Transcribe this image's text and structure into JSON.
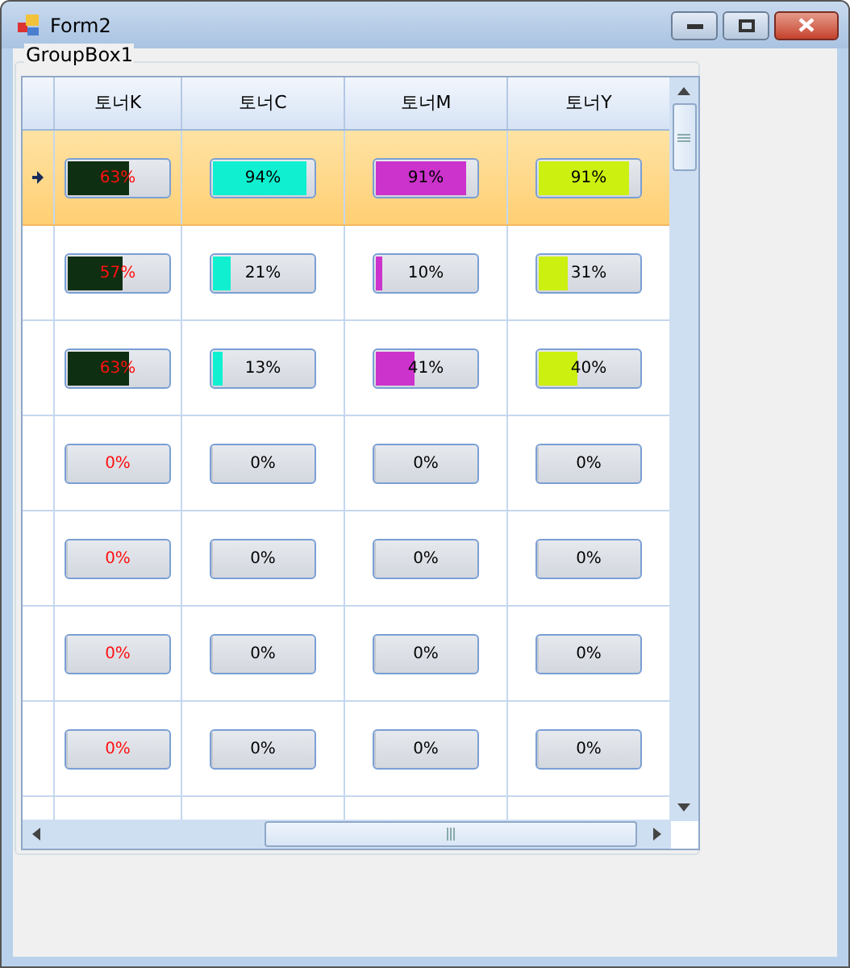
{
  "window": {
    "title": "Form2"
  },
  "group_box": {
    "label": "GroupBox1"
  },
  "table": {
    "columns": [
      {
        "label": "토너K",
        "color": "#0f2f12",
        "kind": "dark"
      },
      {
        "label": "토너C",
        "color": "#10f0d0",
        "kind": "light"
      },
      {
        "label": "토너M",
        "color": "#cc33cc",
        "kind": "light"
      },
      {
        "label": "토너Y",
        "color": "#ccf010",
        "kind": "light"
      }
    ],
    "rows": [
      {
        "selected": true,
        "cells": [
          {
            "text": "63%",
            "level": 0.63
          },
          {
            "text": "94%",
            "level": 0.94
          },
          {
            "text": "91%",
            "level": 0.91
          },
          {
            "text": "91%",
            "level": 0.91
          }
        ]
      },
      {
        "selected": false,
        "cells": [
          {
            "text": "57%",
            "level": 0.57
          },
          {
            "text": "21%",
            "level": 0.21
          },
          {
            "text": "10%",
            "level": 0.1
          },
          {
            "text": "31%",
            "level": 0.31
          }
        ]
      },
      {
        "selected": false,
        "cells": [
          {
            "text": "63%",
            "level": 0.63
          },
          {
            "text": "13%",
            "level": 0.13
          },
          {
            "text": "41%",
            "level": 0.41
          },
          {
            "text": "40%",
            "level": 0.4
          }
        ]
      },
      {
        "selected": false,
        "cells": [
          {
            "text": "0%",
            "level": 0
          },
          {
            "text": "0%",
            "level": 0
          },
          {
            "text": "0%",
            "level": 0
          },
          {
            "text": "0%",
            "level": 0
          }
        ]
      },
      {
        "selected": false,
        "cells": [
          {
            "text": "0%",
            "level": 0
          },
          {
            "text": "0%",
            "level": 0
          },
          {
            "text": "0%",
            "level": 0
          },
          {
            "text": "0%",
            "level": 0
          }
        ]
      },
      {
        "selected": false,
        "cells": [
          {
            "text": "0%",
            "level": 0
          },
          {
            "text": "0%",
            "level": 0
          },
          {
            "text": "0%",
            "level": 0
          },
          {
            "text": "0%",
            "level": 0
          }
        ]
      },
      {
        "selected": false,
        "cells": [
          {
            "text": "0%",
            "level": 0
          },
          {
            "text": "0%",
            "level": 0
          },
          {
            "text": "0%",
            "level": 0
          },
          {
            "text": "0%",
            "level": 0
          }
        ]
      }
    ]
  }
}
